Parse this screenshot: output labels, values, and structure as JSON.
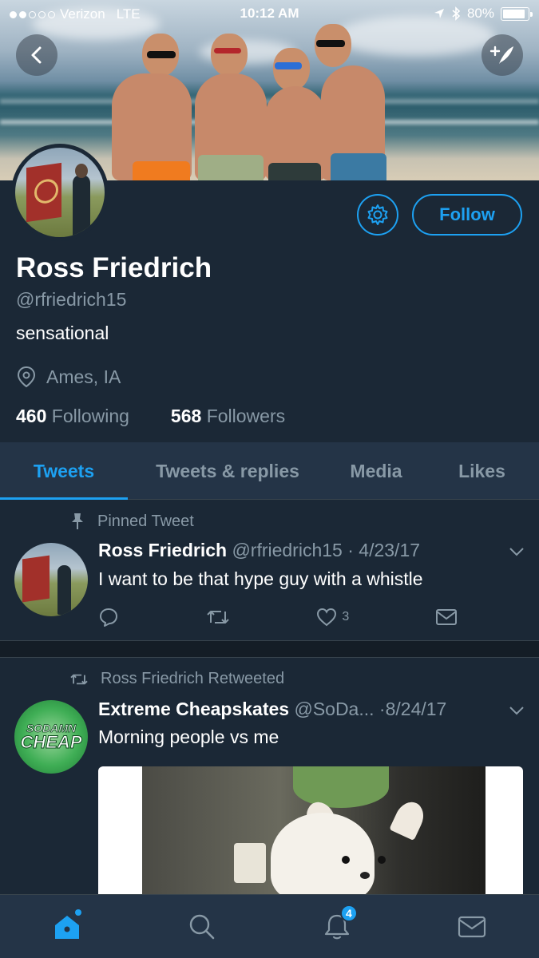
{
  "status_bar": {
    "carrier": "Verizon",
    "network": "LTE",
    "time": "10:12 AM",
    "battery": "80%",
    "battery_level": 0.8
  },
  "header": {
    "back_icon": "chevron-left-icon",
    "compose_icon": "compose-icon"
  },
  "profile": {
    "name": "Ross Friedrich",
    "handle": "@rfriedrich15",
    "bio": "sensational",
    "location": "Ames, IA",
    "following_count": "460",
    "following_label": "Following",
    "followers_count": "568",
    "followers_label": "Followers",
    "follow_label": "Follow"
  },
  "tabs": [
    {
      "label": "Tweets",
      "active": true
    },
    {
      "label": "Tweets & replies",
      "active": false
    },
    {
      "label": "Media",
      "active": false
    },
    {
      "label": "Likes",
      "active": false
    }
  ],
  "tweets": [
    {
      "context": "Pinned Tweet",
      "name": "Ross Friedrich",
      "handle": "@rfriedrich15",
      "date": "4/23/17",
      "text": "I want to be that hype guy with a whistle",
      "likes": "3"
    },
    {
      "context": "Ross Friedrich Retweeted",
      "name": "Extreme Cheapskates",
      "handle": "@SoDa...",
      "date": "8/24/17",
      "text": "Morning people vs me",
      "avatar_logo_text": "SODAMN CHEAP"
    }
  ],
  "bottom_nav": {
    "notifications_badge": "4"
  },
  "colors": {
    "accent": "#1da1f2",
    "background": "#1b2836",
    "secondary_text": "#8899a6"
  }
}
